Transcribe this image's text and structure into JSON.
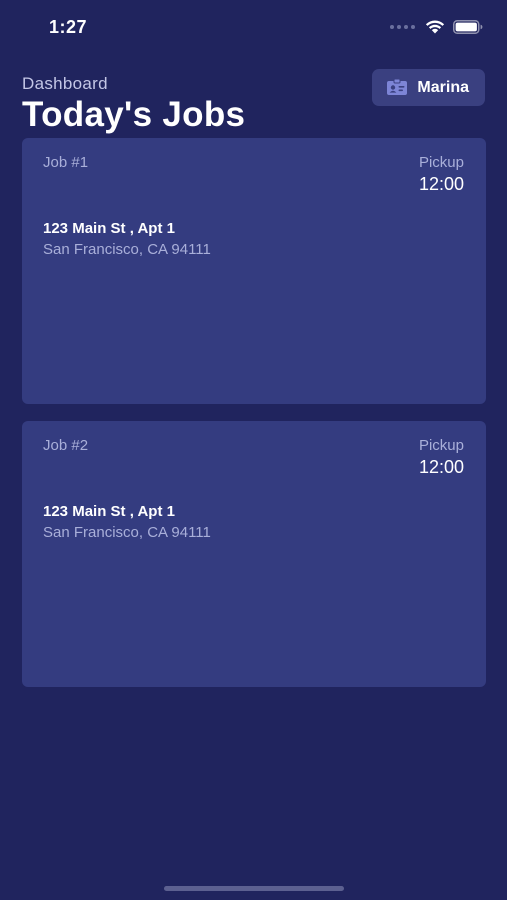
{
  "status_bar": {
    "time": "1:27"
  },
  "header": {
    "subtitle": "Dashboard",
    "title": "Today's Jobs"
  },
  "user": {
    "name": "Marina",
    "icon": "id-card-icon"
  },
  "jobs": [
    {
      "number": "Job #1",
      "pickup_label": "Pickup",
      "pickup_time": "12:00",
      "street": "123 Main St , Apt 1",
      "city": "San Francisco, CA 94111"
    },
    {
      "number": "Job #2",
      "pickup_label": "Pickup",
      "pickup_time": "12:00",
      "street": "123 Main St , Apt 1",
      "city": "San Francisco, CA 94111"
    }
  ],
  "colors": {
    "background": "#20245e",
    "card": "#343c80",
    "button": "#3a4080",
    "muted_text": "#a9afd9"
  }
}
